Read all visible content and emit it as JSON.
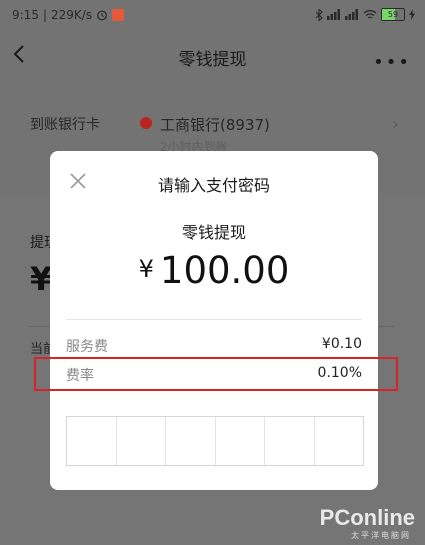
{
  "status_bar": {
    "time": "9:15",
    "speed": "229K/s",
    "battery": "59"
  },
  "nav": {
    "title": "零钱提现"
  },
  "bank_row": {
    "label": "到账银行卡",
    "bank_name": "工商银行(8937)",
    "sub_text": "2小时内到账"
  },
  "sheet": {
    "label": "提现",
    "yen": "¥",
    "balance_label": "当前"
  },
  "dialog": {
    "title": "请输入支付密码",
    "subtitle": "零钱提现",
    "currency": "¥",
    "amount": "100.00",
    "fees": [
      {
        "label": "服务费",
        "value": "¥0.10"
      },
      {
        "label": "费率",
        "value": "0.10%"
      }
    ],
    "pin_length": 6
  },
  "watermark": {
    "brand": "PConline",
    "sub": "太平洋电脑网"
  },
  "colors": {
    "highlight": "#d8232a",
    "bank_logo": "#b8251f",
    "battery": "#79d46a"
  }
}
